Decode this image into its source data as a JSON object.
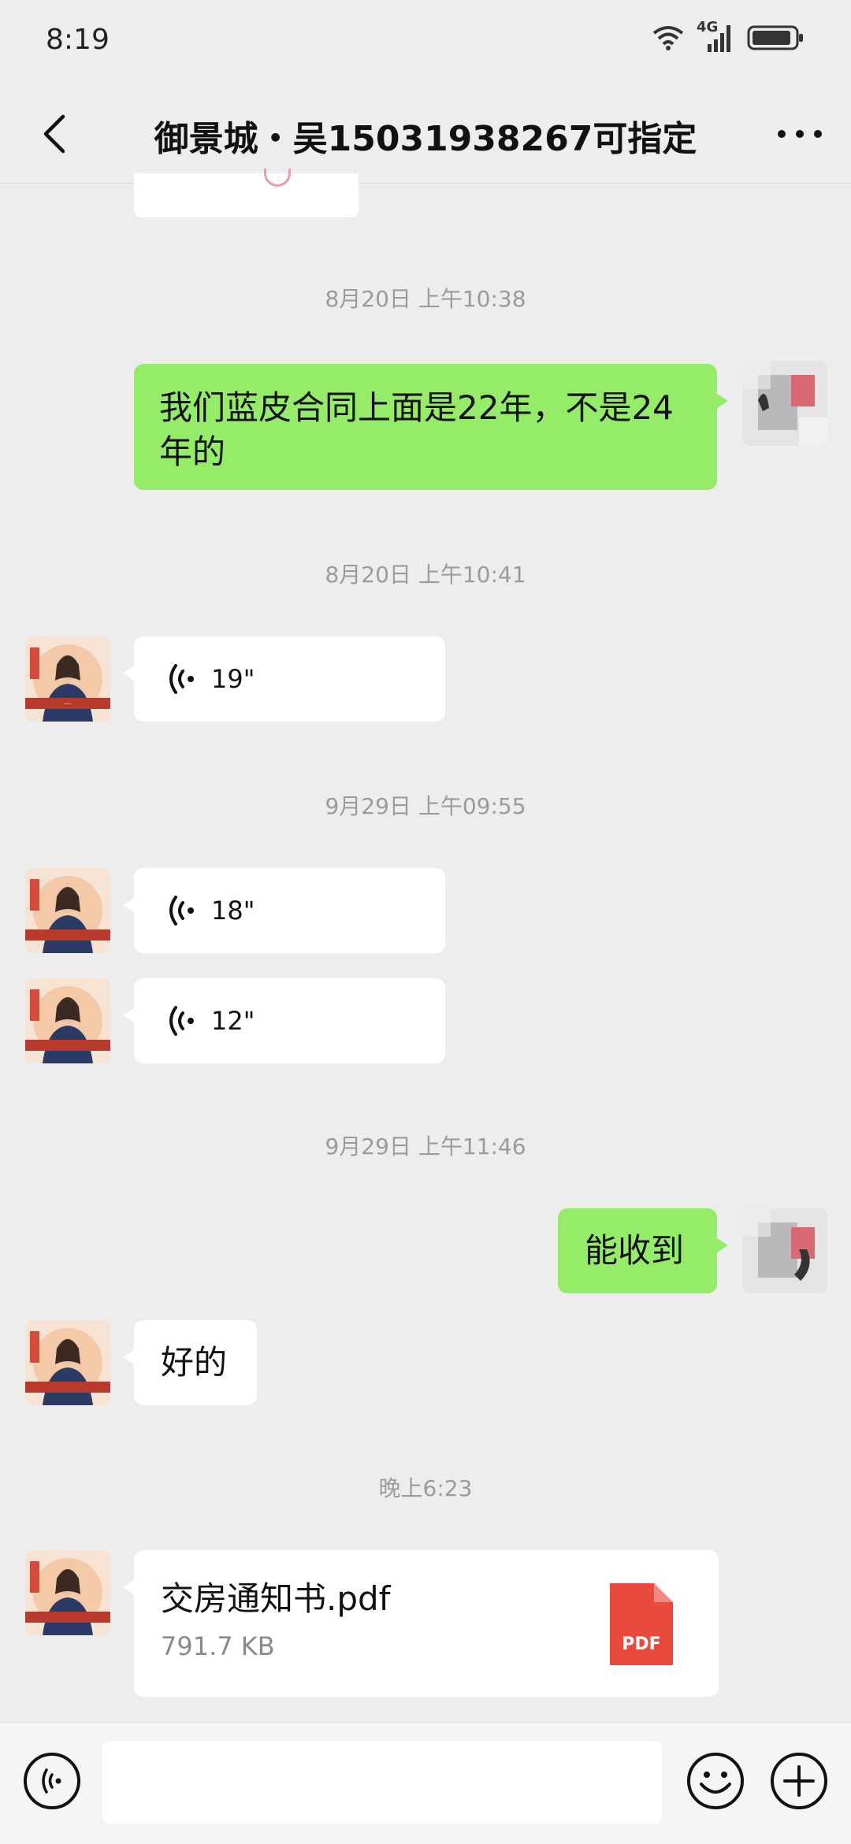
{
  "status_bar": {
    "time": "8:19",
    "network": "4G"
  },
  "header": {
    "title": "御景城・吴15031938267可指定"
  },
  "colors": {
    "background": "#ededed",
    "sent_bubble": "#95ec69",
    "received_bubble": "#ffffff",
    "pdf_icon": "#e84a3d"
  },
  "messages": {
    "ts1": "8月20日 上午10:38",
    "sent1": "我们蓝皮合同上面是22年，不是24年的",
    "ts2": "8月20日 上午10:41",
    "voice1": "19\"",
    "ts3": "9月29日 上午09:55",
    "voice2": "18\"",
    "voice3": "12\"",
    "ts4": "9月29日 上午11:46",
    "sent2": "能收到",
    "recv1": "好的",
    "ts5": "晚上6:23",
    "file_name": "交房通知书.pdf",
    "file_size": "791.7 KB",
    "file_badge": "PDF"
  },
  "icons": {
    "back": "chevron-left-icon",
    "more": "more-dots-icon",
    "voice_input": "voice-icon",
    "emoji": "emoji-icon",
    "add": "plus-icon"
  }
}
